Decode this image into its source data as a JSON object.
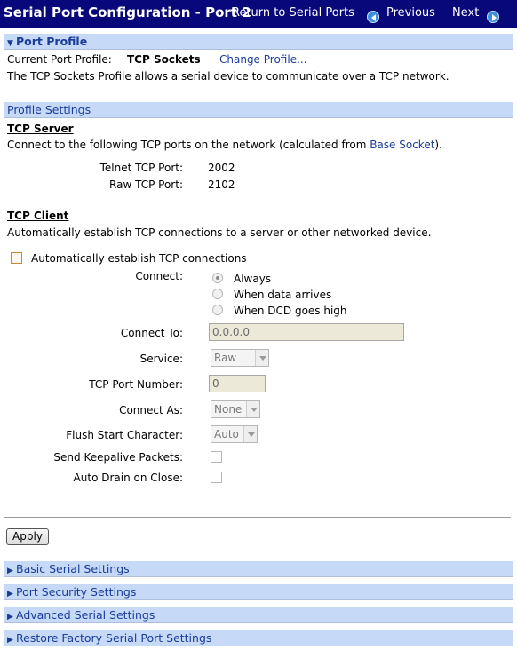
{
  "header": {
    "title": "Serial Port Configuration - Port 2",
    "return_link": "Return to Serial Ports",
    "previous": "Previous",
    "next": "Next"
  },
  "port_profile": {
    "section_label": "Port Profile",
    "current_label": "Current Port Profile:",
    "current_value": "TCP Sockets",
    "change_link": "Change Profile...",
    "description": "The TCP Sockets Profile allows a serial device to communicate over a TCP network."
  },
  "profile_settings": {
    "section_label": "Profile Settings",
    "tcp_server": {
      "heading": "TCP Server",
      "desc_prefix": "Connect to the following TCP ports on the network (calculated from ",
      "desc_link": "Base Socket",
      "desc_suffix": ").",
      "telnet_label": "Telnet TCP Port:",
      "telnet_value": "2002",
      "raw_label": "Raw TCP Port:",
      "raw_value": "2102"
    },
    "tcp_client": {
      "heading": "TCP Client",
      "description": "Automatically establish TCP connections to a server or other networked device.",
      "auto_checkbox_label": "Automatically establish TCP connections",
      "connect_label": "Connect:",
      "connect_options": [
        "Always",
        "When data arrives",
        "When DCD goes high"
      ],
      "connect_selected": "Always",
      "connect_to_label": "Connect To:",
      "connect_to_value": "0.0.0.0",
      "service_label": "Service:",
      "service_value": "Raw",
      "tcp_port_label": "TCP Port Number:",
      "tcp_port_value": "0",
      "connect_as_label": "Connect As:",
      "connect_as_value": "None",
      "flush_label": "Flush Start Character:",
      "flush_value": "Auto",
      "keepalive_label": "Send Keepalive Packets:",
      "auto_drain_label": "Auto Drain on Close:"
    }
  },
  "apply_label": "Apply",
  "collapsed_sections": [
    "Basic Serial Settings",
    "Port Security Settings",
    "Advanced Serial Settings",
    "Restore Factory Serial Port Settings"
  ],
  "colors": {
    "header_bg": "#08087a",
    "section_bar_bg": "#c6d9f7",
    "link": "#1a3d9a"
  },
  "icons": {
    "previous": "arrow-left-circle-icon",
    "next": "arrow-right-circle-icon",
    "expanded": "triangle-down-icon",
    "collapsed": "triangle-right-icon"
  }
}
